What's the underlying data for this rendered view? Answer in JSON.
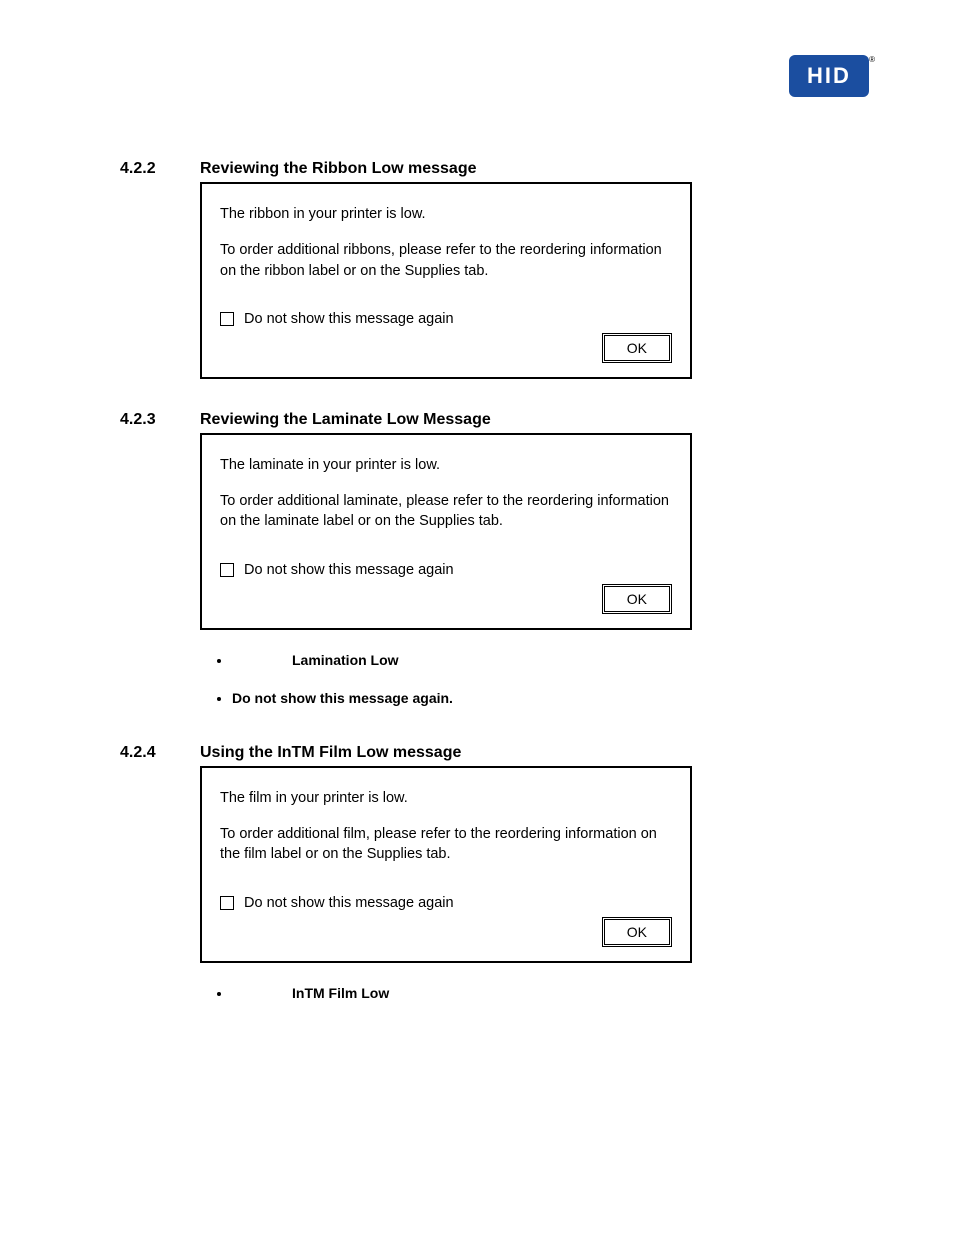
{
  "logo": {
    "text": "HID"
  },
  "sections": [
    {
      "num": "4.2.2",
      "title": "Reviewing the Ribbon Low message",
      "dialog": {
        "line1": "The ribbon in your printer is low.",
        "para": "To order additional ribbons, please refer to the reordering information on the ribbon label or on the Supplies tab.",
        "checkbox_label": "Do not show this message again",
        "ok": "OK"
      }
    },
    {
      "num": "4.2.3",
      "title": "Reviewing the Laminate Low Message",
      "dialog": {
        "line1": "The laminate in your printer is low.",
        "para": "To order additional laminate, please refer to the reordering information on the laminate label or on the Supplies tab.",
        "checkbox_label": "Do not show this message again",
        "ok": "OK"
      },
      "bullets": [
        {
          "bold": "Lamination Low",
          "inset": true
        },
        {
          "bold": "Do not show this message again.",
          "inset": false
        }
      ]
    },
    {
      "num": "4.2.4",
      "title": "Using the InTM Film Low message",
      "dialog": {
        "line1": "The film in your printer is low.",
        "para": "To order additional film, please refer to the reordering information on the film label or on the Supplies tab.",
        "checkbox_label": "Do not show this message again",
        "ok": "OK"
      },
      "bullets": [
        {
          "bold": "InTM Film Low",
          "inset": true
        }
      ]
    }
  ]
}
